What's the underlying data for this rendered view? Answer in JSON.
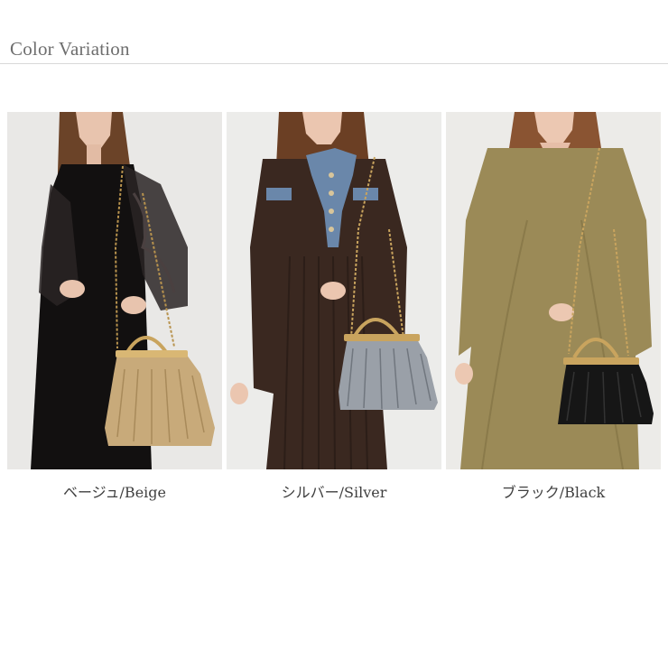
{
  "header": {
    "title": "Color Variation"
  },
  "variants": [
    {
      "caption": "ベージュ/Beige",
      "bag_color": "#c8aa7a",
      "outfit_color": "#121010"
    },
    {
      "caption": "シルバー/Silver",
      "bag_color": "#9aa0a8",
      "outfit_color": "#3a2820"
    },
    {
      "caption": "ブラック/Black",
      "bag_color": "#161616",
      "outfit_color": "#9b8a57"
    }
  ]
}
